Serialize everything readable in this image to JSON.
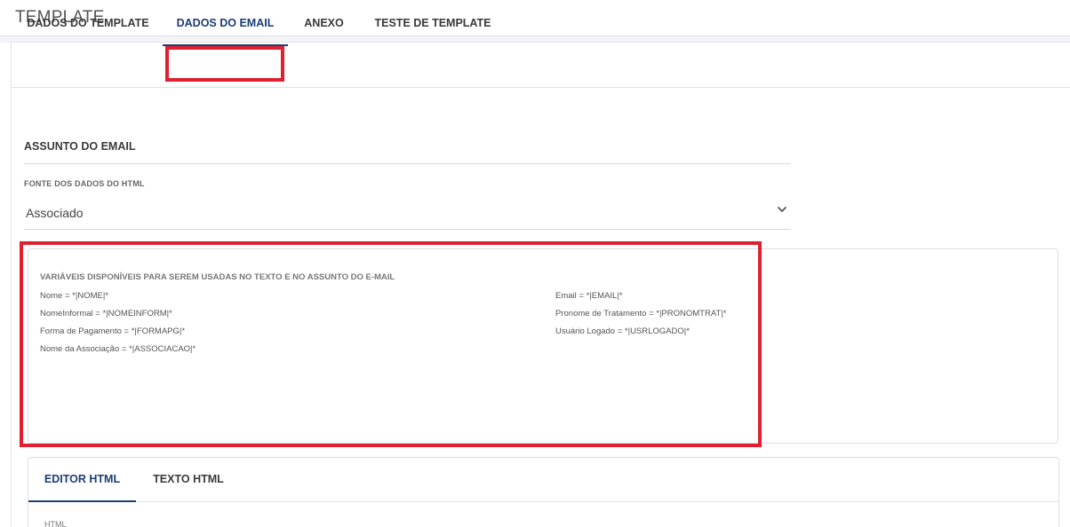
{
  "page": {
    "title": "TEMPLATE"
  },
  "tabs": [
    {
      "label": "DADOS DO TEMPLATE",
      "active": false
    },
    {
      "label": "DADOS DO EMAIL",
      "active": true
    },
    {
      "label": "ANEXO",
      "active": false
    },
    {
      "label": "TESTE DE TEMPLATE",
      "active": false
    }
  ],
  "email": {
    "section_title": "ASSUNTO DO EMAIL",
    "source_label": "FONTE DOS DADOS DO HTML",
    "source_value": "Associado"
  },
  "variables": {
    "title": "VARIÁVEIS DISPONÍVEIS PARA SEREM USADAS NO TEXTO E NO ASSUNTO DO E-MAIL",
    "left": [
      "Nome = *|NOME|*",
      "NomeInformal = *|NOMEINFORM|*",
      "Forma de Pagamento = *|FORMAPG|*",
      "Nome da Associação = *|ASSOCIACAO|*"
    ],
    "right": [
      "Email = *|EMAIL|*",
      "Pronome de Tratamento = *|PRONOMTRAT|*",
      "Usuário Logado = *|USRLOGADO|*"
    ]
  },
  "editor": {
    "tabs": [
      {
        "label": "EDITOR HTML",
        "active": true
      },
      {
        "label": "TEXTO HTML",
        "active": false
      }
    ],
    "field_label": "HTML"
  },
  "colors": {
    "accent": "#1d3d75",
    "highlight": "#e02030"
  },
  "icons": {
    "select_chevron": "chevron-down-icon"
  }
}
